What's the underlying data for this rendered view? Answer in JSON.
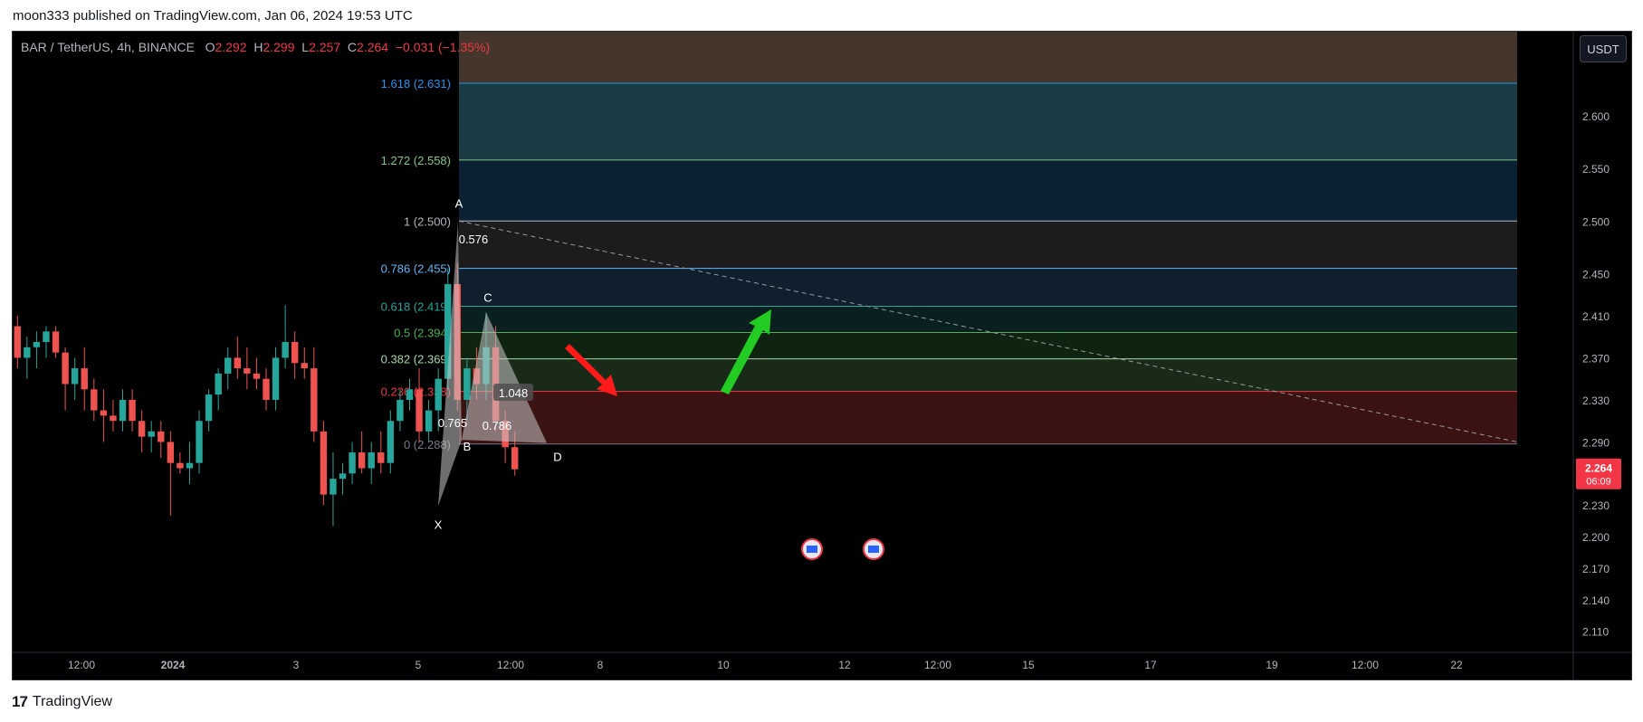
{
  "header": {
    "published_text": "moon333 published on TradingView.com, Jan 06, 2024 19:53 UTC"
  },
  "legend": {
    "symbol": "BAR / TetherUS, 4h, BINANCE",
    "o_label": "O",
    "o_value": "2.292",
    "h_label": "H",
    "h_value": "2.299",
    "l_label": "L",
    "l_value": "2.257",
    "c_label": "C",
    "c_value": "2.264",
    "change": "−0.031 (−1.35%)"
  },
  "unit_button": "USDT",
  "footer": {
    "brand": "TradingView",
    "logo_glyph": "17"
  },
  "colors": {
    "up": "#26a69a",
    "down": "#ef5350",
    "price_tag": "#f23645",
    "bg": "#000000"
  },
  "chart_data": {
    "type": "candlestick",
    "price_scale": {
      "min": 2.09,
      "max": 2.68,
      "ticks": [
        "2.600",
        "2.550",
        "2.500",
        "2.450",
        "2.410",
        "2.370",
        "2.330",
        "2.290",
        "2.230",
        "2.200",
        "2.170",
        "2.140",
        "2.110"
      ]
    },
    "time_axis": [
      "12:00",
      "2024",
      "3",
      "5",
      "12:00",
      "8",
      "10",
      "12",
      "12:00",
      "15",
      "17",
      "19",
      "12:00",
      "22"
    ],
    "last_price": {
      "value": 2.264,
      "label": "2.264",
      "countdown": "06:09"
    },
    "fib_levels": [
      {
        "ratio": "1.618",
        "price": 2.631,
        "label": "1.618 (2.631)",
        "color": "#2196f3",
        "fill": "#1f3c3c"
      },
      {
        "ratio": "1.272",
        "price": 2.558,
        "label": "1.272 (2.558)",
        "color": "#81c784",
        "fill": "#1a3a44"
      },
      {
        "ratio": "1",
        "price": 2.5,
        "label": "1 (2.500)",
        "color": "#b2b5be",
        "fill": "#0a2033"
      },
      {
        "ratio": "0.786",
        "price": 2.455,
        "label": "0.786 (2.455)",
        "color": "#64b5f6",
        "fill": "#1c1c1c"
      },
      {
        "ratio": "0.618",
        "price": 2.419,
        "label": "0.618 (2.419)",
        "color": "#26a69a",
        "fill": "#0f1f2e"
      },
      {
        "ratio": "0.5",
        "price": 2.394,
        "label": "0.5 (2.394)",
        "color": "#4caf50",
        "fill": "#0a2020"
      },
      {
        "ratio": "0.382",
        "price": 2.369,
        "label": "0.382 (2.369)",
        "color": "#a5d6a7",
        "fill": "#0f2410"
      },
      {
        "ratio": "0.236",
        "price": 2.338,
        "label": "0.236 (2.338)",
        "color": "#f23645",
        "fill": "#1a2a18"
      },
      {
        "ratio": "0",
        "price": 2.288,
        "label": "0 (2.288)",
        "color": "#787b86",
        "fill": "#3a1212"
      }
    ],
    "top_band": {
      "price_top": 2.68,
      "price_bottom": 2.631,
      "fill": "#44362a"
    },
    "harmonic_pattern": {
      "points": [
        {
          "label": "X",
          "t": 0,
          "price": 2.229
        },
        {
          "label": "A",
          "t": 1,
          "price": 2.5
        },
        {
          "label": "B",
          "t": 2,
          "price": 2.292
        },
        {
          "label": "C",
          "t": 3,
          "price": 2.413
        },
        {
          "label": "D",
          "t": 4,
          "price": 2.289
        }
      ],
      "ratios": [
        "0.576",
        "0.765",
        "0.786",
        "1.048"
      ]
    },
    "candles": [
      [
        2.4,
        2.41,
        2.36,
        2.37
      ],
      [
        2.37,
        2.39,
        2.35,
        2.38
      ],
      [
        2.38,
        2.395,
        2.36,
        2.385
      ],
      [
        2.385,
        2.4,
        2.37,
        2.395
      ],
      [
        2.395,
        2.4,
        2.37,
        2.375
      ],
      [
        2.375,
        2.38,
        2.32,
        2.345
      ],
      [
        2.345,
        2.37,
        2.33,
        2.36
      ],
      [
        2.36,
        2.38,
        2.32,
        2.34
      ],
      [
        2.34,
        2.35,
        2.31,
        2.32
      ],
      [
        2.32,
        2.34,
        2.29,
        2.315
      ],
      [
        2.315,
        2.33,
        2.3,
        2.31
      ],
      [
        2.31,
        2.34,
        2.3,
        2.33
      ],
      [
        2.33,
        2.34,
        2.3,
        2.31
      ],
      [
        2.31,
        2.32,
        2.28,
        2.295
      ],
      [
        2.295,
        2.31,
        2.28,
        2.3
      ],
      [
        2.3,
        2.31,
        2.275,
        2.29
      ],
      [
        2.29,
        2.3,
        2.22,
        2.27
      ],
      [
        2.27,
        2.28,
        2.26,
        2.265
      ],
      [
        2.265,
        2.29,
        2.25,
        2.27
      ],
      [
        2.27,
        2.32,
        2.26,
        2.31
      ],
      [
        2.31,
        2.34,
        2.3,
        2.335
      ],
      [
        2.335,
        2.36,
        2.32,
        2.355
      ],
      [
        2.355,
        2.38,
        2.34,
        2.37
      ],
      [
        2.37,
        2.39,
        2.35,
        2.36
      ],
      [
        2.36,
        2.38,
        2.34,
        2.355
      ],
      [
        2.355,
        2.37,
        2.34,
        2.35
      ],
      [
        2.35,
        2.36,
        2.32,
        2.33
      ],
      [
        2.33,
        2.38,
        2.32,
        2.37
      ],
      [
        2.37,
        2.42,
        2.36,
        2.385
      ],
      [
        2.385,
        2.395,
        2.35,
        2.365
      ],
      [
        2.365,
        2.38,
        2.35,
        2.36
      ],
      [
        2.36,
        2.38,
        2.29,
        2.3
      ],
      [
        2.3,
        2.31,
        2.23,
        2.24
      ],
      [
        2.24,
        2.28,
        2.21,
        2.255
      ],
      [
        2.255,
        2.27,
        2.24,
        2.26
      ],
      [
        2.26,
        2.29,
        2.25,
        2.28
      ],
      [
        2.28,
        2.3,
        2.26,
        2.265
      ],
      [
        2.265,
        2.29,
        2.25,
        2.28
      ],
      [
        2.28,
        2.3,
        2.26,
        2.27
      ],
      [
        2.27,
        2.32,
        2.26,
        2.31
      ],
      [
        2.31,
        2.34,
        2.3,
        2.33
      ],
      [
        2.33,
        2.35,
        2.32,
        2.34
      ],
      [
        2.34,
        2.36,
        2.29,
        2.3
      ],
      [
        2.3,
        2.33,
        2.29,
        2.32
      ],
      [
        2.32,
        2.36,
        2.3,
        2.35
      ],
      [
        2.35,
        2.455,
        2.34,
        2.44
      ],
      [
        2.44,
        2.46,
        2.32,
        2.33
      ],
      [
        2.33,
        2.37,
        2.31,
        2.36
      ],
      [
        2.36,
        2.38,
        2.33,
        2.345
      ],
      [
        2.345,
        2.413,
        2.33,
        2.38
      ],
      [
        2.38,
        2.4,
        2.3,
        2.31
      ],
      [
        2.31,
        2.32,
        2.27,
        2.285
      ],
      [
        2.285,
        2.3,
        2.258,
        2.264
      ]
    ]
  }
}
